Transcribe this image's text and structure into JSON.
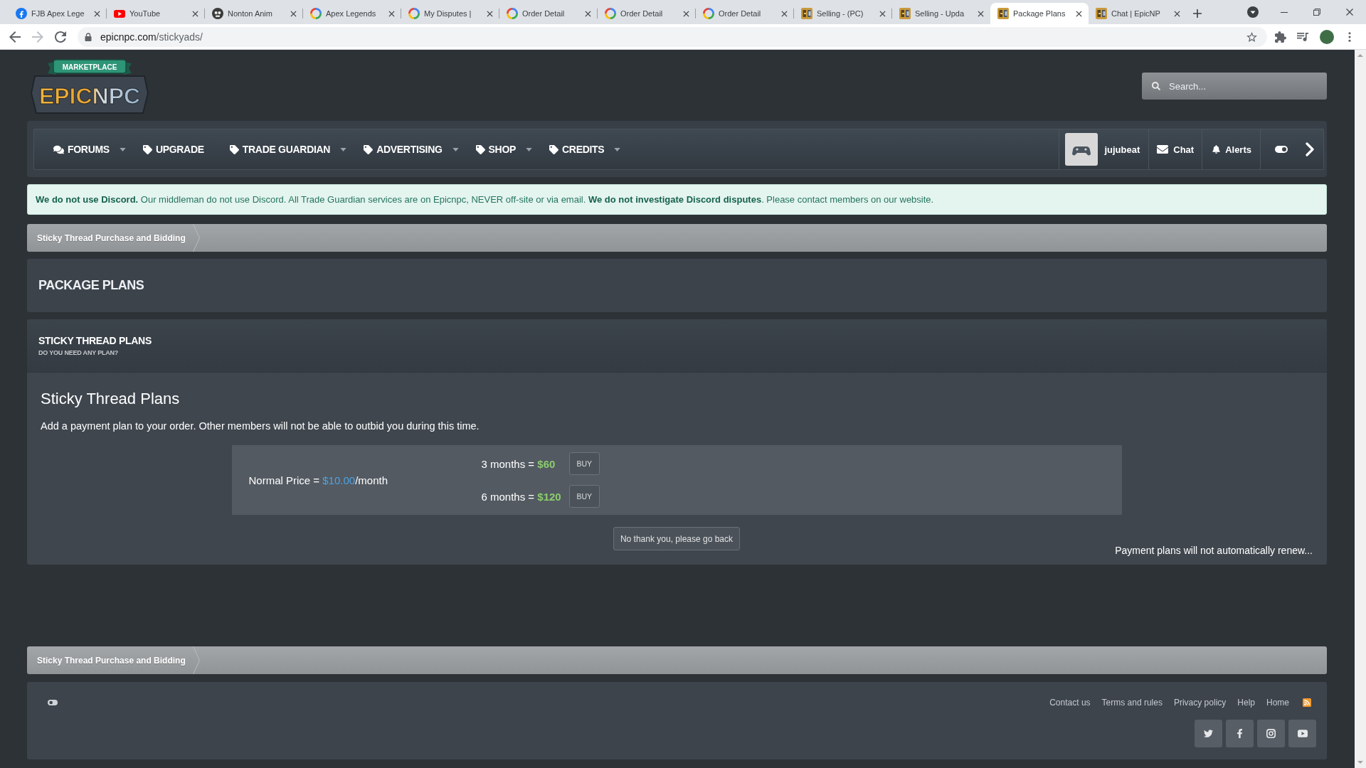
{
  "browser": {
    "tabs": [
      {
        "title": "FJB Apex Lege",
        "kind": "facebook",
        "selected": false
      },
      {
        "title": "YouTube",
        "kind": "youtube",
        "selected": false
      },
      {
        "title": "Nonton Anim",
        "kind": "skull",
        "selected": false
      },
      {
        "title": "Apex Legends",
        "kind": "swirl",
        "selected": false
      },
      {
        "title": "My Disputes |",
        "kind": "swirl",
        "selected": false
      },
      {
        "title": "Order Detail",
        "kind": "swirl",
        "selected": false
      },
      {
        "title": "Order Detail",
        "kind": "swirl",
        "selected": false
      },
      {
        "title": "Order Detail",
        "kind": "swirl",
        "selected": false
      },
      {
        "title": "Selling - (PC)",
        "kind": "tile",
        "selected": false
      },
      {
        "title": "Selling - Upda",
        "kind": "tile",
        "selected": false
      },
      {
        "title": "Package Plans",
        "kind": "tile",
        "selected": true
      },
      {
        "title": "Chat | EpicNP",
        "kind": "tile",
        "selected": false
      }
    ],
    "nav_buttons": [
      {
        "kind": "back",
        "disabled": false
      },
      {
        "kind": "forward",
        "disabled": true
      },
      {
        "kind": "reload",
        "disabled": false
      }
    ],
    "url": {
      "host": "epicnpc.com",
      "path": "/stickyads/"
    }
  },
  "header": {
    "logo": {
      "banner": "MARKETPLACE",
      "wordmark": "EPICNPC"
    },
    "search": {
      "placeholder": "Search..."
    }
  },
  "nav": {
    "items": [
      {
        "label": "FORUMS",
        "kind": "comments",
        "has_menu": true
      },
      {
        "label": "UPGRADE",
        "kind": "tag",
        "has_menu": false
      },
      {
        "label": "TRADE GUARDIAN",
        "kind": "tag",
        "has_menu": true
      },
      {
        "label": "ADVERTISING",
        "kind": "tag",
        "has_menu": true
      },
      {
        "label": "SHOP",
        "kind": "tag",
        "has_menu": true
      },
      {
        "label": "CREDITS",
        "kind": "tag",
        "has_menu": true
      }
    ],
    "user": {
      "name": "jujubeat"
    },
    "links": [
      {
        "label": "Chat",
        "kind": "envelope"
      },
      {
        "label": "Alerts",
        "kind": "bell"
      }
    ]
  },
  "notice": "**We do not use Discord.** Our middleman do not use Discord. All Trade Guardian services are on Epicnpc, NEVER off-site or via email. **We do not investigate Discord disputes**. Please contact members on our website.",
  "breadcrumb_top": [
    "Sticky Thread Purchase and Bidding"
  ],
  "page_title": "PACKAGE PLANS",
  "plans_block": {
    "title": "STICKY THREAD PLANS",
    "subtitle": "DO YOU NEED ANY PLAN?",
    "heading": "Sticky Thread Plans",
    "intro": "Add a payment plan to your order. Other members will not be able to outbid you during this time.",
    "normal_price": {
      "label": "Normal Price =",
      "amount": "$10.00",
      "unit": "/month"
    },
    "plans": [
      {
        "term": "3 months =",
        "price": "$60",
        "button": "BUY"
      },
      {
        "term": "6 months =",
        "price": "$120",
        "button": "BUY"
      }
    ],
    "decline_button": "No thank you, please go back",
    "note": "Payment plans will not automatically renew..."
  },
  "breadcrumb_bottom": [
    "Sticky Thread Purchase and Bidding"
  ],
  "footer": {
    "links": [
      "Contact us",
      "Terms and rules",
      "Privacy policy",
      "Help",
      "Home"
    ]
  }
}
